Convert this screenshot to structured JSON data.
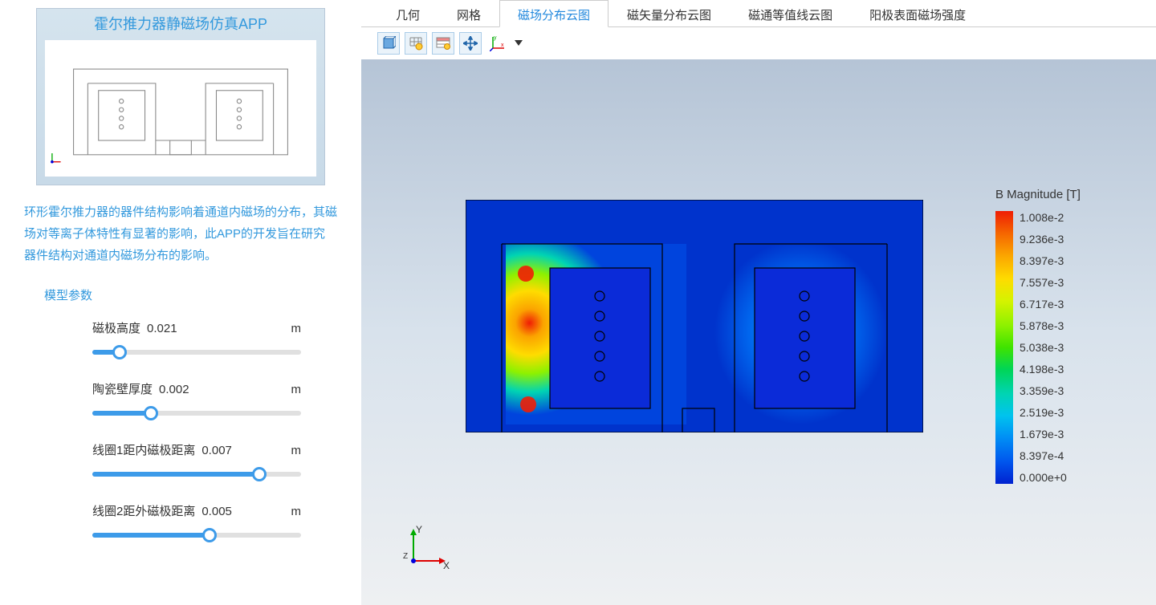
{
  "header": {
    "title": "霍尔推力器静磁场仿真APP"
  },
  "description": "环形霍尔推力器的器件结构影响着通道内磁场的分布，其磁场对等离子体特性有显著的影响，此APP的开发旨在研究器件结构对通道内磁场分布的影响。",
  "section": {
    "params_title": "模型参数"
  },
  "params": [
    {
      "label": "磁极高度",
      "value": "0.021",
      "unit": "m",
      "fill_pct": 13
    },
    {
      "label": "陶瓷壁厚度",
      "value": "0.002",
      "unit": "m",
      "fill_pct": 28
    },
    {
      "label": "线圈1距内磁极距离",
      "value": "0.007",
      "unit": "m",
      "fill_pct": 80
    },
    {
      "label": "线圈2距外磁极距离",
      "value": "0.005",
      "unit": "m",
      "fill_pct": 56
    }
  ],
  "tabs": [
    {
      "label": "几何",
      "active": false
    },
    {
      "label": "网格",
      "active": false
    },
    {
      "label": "磁场分布云图",
      "active": true
    },
    {
      "label": "磁矢量分布云图",
      "active": false
    },
    {
      "label": "磁通等值线云图",
      "active": false
    },
    {
      "label": "阳极表面磁场强度",
      "active": false
    }
  ],
  "toolbar_icons": [
    "cube-icon",
    "grid-icon",
    "table-icon",
    "move-icon",
    "axes-icon",
    "dropdown-icon"
  ],
  "legend": {
    "title": "B Magnitude [T]",
    "labels": [
      "1.008e-2",
      "9.236e-3",
      "8.397e-3",
      "7.557e-3",
      "6.717e-3",
      "5.878e-3",
      "5.038e-3",
      "4.198e-3",
      "3.359e-3",
      "2.519e-3",
      "1.679e-3",
      "8.397e-4",
      "0.000e+0"
    ]
  },
  "axis": {
    "x": "X",
    "y": "Y",
    "z": "Z"
  }
}
